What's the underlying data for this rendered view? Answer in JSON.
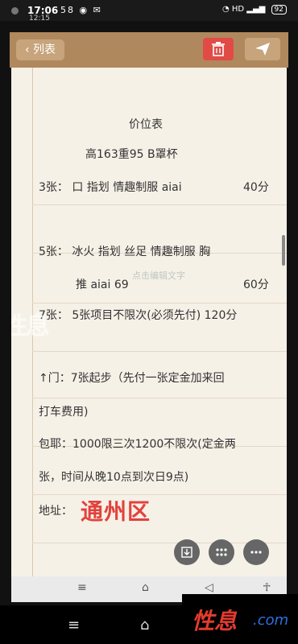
{
  "status": {
    "time": "17:06",
    "sub_time": "12:15",
    "left_icons": "58",
    "right_icons": "HD",
    "battery": "92"
  },
  "toolbar": {
    "back_label": "列表"
  },
  "note": {
    "title": "价位表",
    "lines": [
      {
        "text": "高163重95 B罩杯"
      },
      {
        "text": "3张： 口 指划 情趣制服 aiai",
        "right": "40分"
      },
      {
        "text": "5张： 冰火 指划 丝足 情趣制服 胸"
      },
      {
        "text": "推 aiai 69",
        "right": "60分"
      },
      {
        "text": "7张： 5张项目不限次(必须先付) 120分"
      },
      {
        "text": "↑门：7张起步（先付一张定金加来回"
      },
      {
        "text": "打车费用)"
      },
      {
        "text": "包耶：1000限三次1200不限次(定金两"
      },
      {
        "text": "张，时间从晚10点到次日9点)"
      },
      {
        "text": "地址："
      }
    ],
    "overlay": "点击编辑文字",
    "address_big": "通州区",
    "watermark": "性息"
  },
  "bottom_brand": {
    "main": "性息",
    ".com": ".com"
  }
}
